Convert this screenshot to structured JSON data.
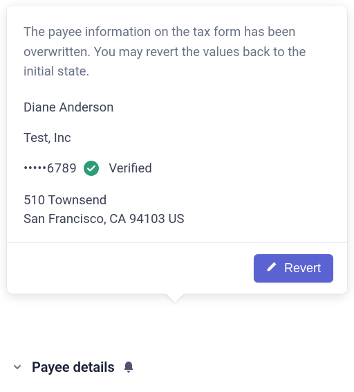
{
  "popover": {
    "info_text": "The payee information on the tax form has been overwritten. You may revert the values back to the initial state.",
    "payee_name": "Diane Anderson",
    "company": "Test, Inc",
    "taxid_masked": "•••••6789",
    "verified_label": "Verified",
    "address_line1": "510 Townsend",
    "address_line2": "San Francisco, CA 94103 US",
    "revert_label": "Revert"
  },
  "section": {
    "title": "Payee details"
  },
  "colors": {
    "accent": "#5b63d3",
    "verified": "#2d9d78"
  }
}
